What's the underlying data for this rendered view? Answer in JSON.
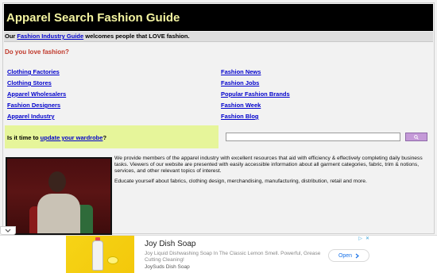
{
  "header": {
    "title": "Apparel Search Fashion Guide"
  },
  "welcome": {
    "prefix": "Our ",
    "link": "Fashion Industry Guide",
    "suffix": " welcomes people that LOVE fashion."
  },
  "question": "Do you love fashion?",
  "links_left": [
    "Clothing Factories",
    "Clothing Stores",
    "Apparel Wholesalers",
    "Fashion Designers",
    "Apparel Industry"
  ],
  "links_right": [
    "Fashion News",
    "Fashion Jobs",
    "Popular Fashion Brands",
    "Fashion Week",
    "Fashion Blog"
  ],
  "wardrobe": {
    "prefix": "Is it time to ",
    "link": "update your wardrobe",
    "suffix": "?"
  },
  "search": {
    "value": "",
    "placeholder": ""
  },
  "body": {
    "p1": "We provide members of the apparel industry with excellent resources that aid with efficiency & effectively completing daily business tasks. Viewers of our website are presented with easily accessible information about all garment categories, fabric, trim & notions, services, and other relevant topics of interest.",
    "p2": "Educate yourself about fabrics, clothing design, merchandising, manufacturing, distribution, retail and more."
  },
  "ad": {
    "title": "Joy Dish Soap",
    "description": "Joy Liquid Dishwashing Soap In The Classic Lemon Smell. Powerful, Grease Cutting Cleaning!",
    "brand": "JoySuds Dish Soap",
    "open_label": "Open"
  },
  "colors": {
    "header_bg": "#000000",
    "title": "#f3f3a0",
    "link": "#0000cc",
    "question": "#c0392b",
    "wardrobe_bg": "#e6f59a",
    "search_button": "#c59ad8"
  }
}
